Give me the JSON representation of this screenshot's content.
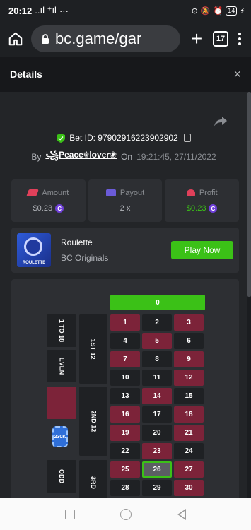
{
  "status_bar": {
    "time": "20:12",
    "signal": "..ıl ⁺ıl",
    "more": "···",
    "battery": "14"
  },
  "browser": {
    "url": "bc.game/gar",
    "tab_count": "17"
  },
  "details": {
    "title": "Details",
    "close": "×"
  },
  "bet": {
    "bet_id_label": "Bet ID: 97902916223902902",
    "by_label": "By",
    "user": "꧁Peace☬lover❀",
    "on_label": "On",
    "timestamp": "19:21:45, 27/11/2022"
  },
  "stats": [
    {
      "label": "Amount",
      "value": "$0.23",
      "icon": "amount-icon",
      "value_color": "#b0b3b8"
    },
    {
      "label": "Payout",
      "value": "2 x",
      "icon": "payout-icon",
      "value_color": "#b0b3b8"
    },
    {
      "label": "Profit",
      "value": "$0.23",
      "icon": "profit-icon",
      "value_color": "#3bc117"
    }
  ],
  "coin_symbol": "C",
  "game": {
    "thumb_label": "ROULETTE",
    "name": "Roulette",
    "provider": "BC Originals",
    "play_label": "Play Now"
  },
  "roulette": {
    "zero": "0",
    "selected_number": "26",
    "chip_label": "230K",
    "side_bets": {
      "low": "1 TO 18",
      "even": "EVEN",
      "odd": "ODD",
      "dozen1": "1ST 12",
      "dozen2": "2ND 12",
      "dozen3": "3RD"
    },
    "rows": [
      [
        {
          "n": "1",
          "c": "red"
        },
        {
          "n": "2",
          "c": "black"
        },
        {
          "n": "3",
          "c": "red"
        }
      ],
      [
        {
          "n": "4",
          "c": "black"
        },
        {
          "n": "5",
          "c": "red"
        },
        {
          "n": "6",
          "c": "black"
        }
      ],
      [
        {
          "n": "7",
          "c": "red"
        },
        {
          "n": "8",
          "c": "black"
        },
        {
          "n": "9",
          "c": "red"
        }
      ],
      [
        {
          "n": "10",
          "c": "black"
        },
        {
          "n": "11",
          "c": "black"
        },
        {
          "n": "12",
          "c": "red"
        }
      ],
      [
        {
          "n": "13",
          "c": "black"
        },
        {
          "n": "14",
          "c": "red"
        },
        {
          "n": "15",
          "c": "black"
        }
      ],
      [
        {
          "n": "16",
          "c": "red"
        },
        {
          "n": "17",
          "c": "black"
        },
        {
          "n": "18",
          "c": "red"
        }
      ],
      [
        {
          "n": "19",
          "c": "red"
        },
        {
          "n": "20",
          "c": "black"
        },
        {
          "n": "21",
          "c": "red"
        }
      ],
      [
        {
          "n": "22",
          "c": "black"
        },
        {
          "n": "23",
          "c": "red"
        },
        {
          "n": "24",
          "c": "black"
        }
      ],
      [
        {
          "n": "25",
          "c": "red"
        },
        {
          "n": "26",
          "c": "sel"
        },
        {
          "n": "27",
          "c": "red"
        }
      ],
      [
        {
          "n": "28",
          "c": "black"
        },
        {
          "n": "29",
          "c": "black"
        },
        {
          "n": "30",
          "c": "red"
        }
      ]
    ]
  },
  "colors": {
    "accent_green": "#3bc117",
    "red_cell": "#7c2339",
    "black_cell": "#1f2124",
    "panel": "#2d2f33"
  }
}
